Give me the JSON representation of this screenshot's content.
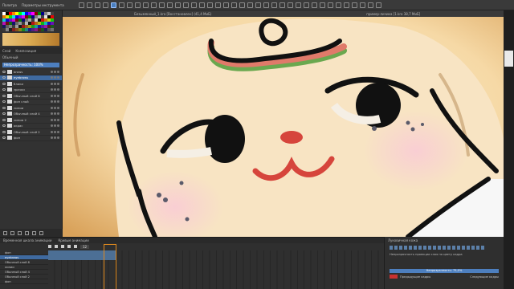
{
  "topbar": {
    "menu": [
      "Палитра",
      "Параметры инструмента"
    ],
    "tool_count": 38
  },
  "left_panel": {
    "tabs": [
      "Слой",
      "Композиция"
    ],
    "blend_mode": "Обычный",
    "opacity_label": "Непрозрачность: 100%",
    "layers": [
      {
        "name": "brows",
        "selected": false
      },
      {
        "name": "eyebrows",
        "selected": true
      },
      {
        "name": "блики",
        "selected": false
      },
      {
        "name": "зрачки",
        "selected": false
      },
      {
        "name": "Обычный слой 8",
        "selected": false
      },
      {
        "name": "фон слой",
        "selected": false
      },
      {
        "name": "линии",
        "selected": false
      },
      {
        "name": "Обычный слой 4",
        "selected": false
      },
      {
        "name": "линии 2",
        "selected": false
      },
      {
        "name": "окрас",
        "selected": false
      },
      {
        "name": "Обычный слой 2",
        "selected": false
      },
      {
        "name": "фон",
        "selected": false
      }
    ]
  },
  "doc_tabs": [
    "Безымянный_1.kra [Восстановлен] (41,4 МиБ)",
    "пример-личика [1.kra 38,7 МиБ]"
  ],
  "timeline": {
    "tabs": [
      "Временная шкала анимации",
      "Кривые анимации"
    ],
    "fps_label": "12",
    "layer_rows": [
      {
        "name": "фон",
        "selected": false
      },
      {
        "name": "eyebrows",
        "selected": true
      },
      {
        "name": "Обычный слой 8",
        "selected": false
      },
      {
        "name": "линии",
        "selected": false
      },
      {
        "name": "Обычный слой 4",
        "selected": false
      },
      {
        "name": "Обычный слой 2",
        "selected": false
      },
      {
        "name": "фон",
        "selected": false
      }
    ],
    "ruler": [
      "0",
      "3",
      "6",
      "9",
      "12",
      "15",
      "18",
      "21",
      "24",
      "27",
      "30",
      "33",
      "36",
      "39",
      "42",
      "45",
      "48",
      "51"
    ]
  },
  "bottom_right": {
    "title": "Луковичная кожа",
    "bars_label": "Непрозрачность проекции слоя по цвету кадра",
    "opacity_label": "Непрозрачность: 75,0%",
    "prev_label": "Предыдущие кадры",
    "next_label": "Следующие кадры"
  }
}
